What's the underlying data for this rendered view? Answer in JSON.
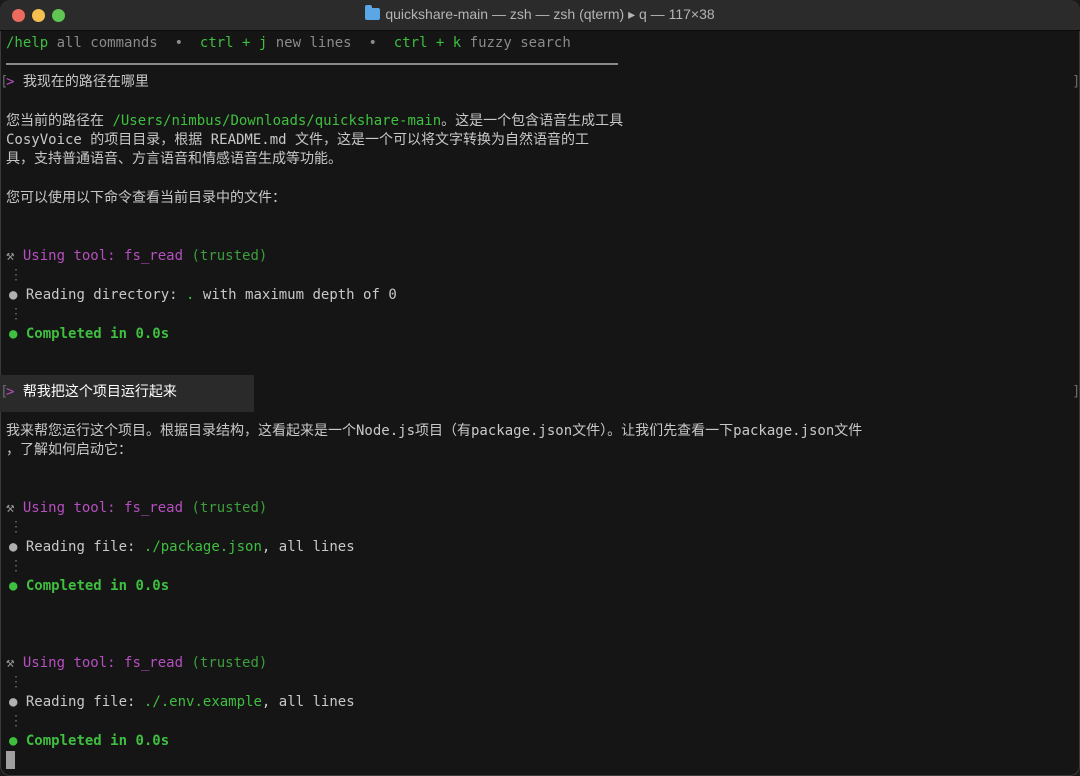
{
  "window": {
    "title": "quickshare-main — zsh — zsh (qterm) ▸ q — 117×38"
  },
  "help_bar": {
    "help_cmd": "/help",
    "help_desc": " all commands",
    "sep1": "  •  ",
    "ctrlj": "ctrl + j",
    "ctrlj_desc": " new lines",
    "sep2": "  •  ",
    "ctrlk": "ctrl + k",
    "ctrlk_desc": " fuzzy search"
  },
  "prompt_char": ">",
  "bracket_left": "[",
  "bracket_right": "]",
  "conversation": {
    "q1": "我现在的路径在哪里",
    "a1_line1_pre": "您当前的路径在 ",
    "a1_path": "/Users/nimbus/Downloads/quickshare-main",
    "a1_line1_post": "。这是一个包含语音生成工具",
    "a1_line2": "CosyVoice 的项目目录，根据 README.md 文件，这是一个可以将文字转换为自然语音的工",
    "a1_line3": "具，支持普通语音、方言语音和情感语音生成等功能。",
    "a1_line4": "您可以使用以下命令查看当前目录中的文件：",
    "tool1_using": "Using tool: fs_read",
    "tool1_trusted": " (trusted)",
    "tool1_reading_label": "Reading directory: ",
    "tool1_reading_target": ".",
    "tool1_reading_rest": " with maximum depth of 0",
    "tool1_completed": "Completed in 0.0s",
    "q2": "帮我把这个项目运行起来",
    "a2_line1": "我来帮您运行这个项目。根据目录结构，这看起来是一个Node.js项目（有package.json文件）。让我们先查看一下package.json文件",
    "a2_line2": "，了解如何启动它：",
    "tool2_using": "Using tool: fs_read",
    "tool2_trusted": " (trusted)",
    "tool2_reading_label": "Reading file: ",
    "tool2_reading_target": "./package.json",
    "tool2_reading_rest": ", all lines",
    "tool2_completed": "Completed in 0.0s",
    "tool3_using": "Using tool: fs_read",
    "tool3_trusted": " (trusted)",
    "tool3_reading_label": "Reading file: ",
    "tool3_reading_target": "./.env.example",
    "tool3_reading_rest": ", all lines",
    "tool3_completed": "Completed in 0.0s"
  },
  "glyphs": {
    "tool_icon": "⚒",
    "bullet": "●",
    "vdots": "⋮"
  },
  "icons": {
    "folder": "folder-icon",
    "tool": "hammer-wrench-icon",
    "bullet": "status-dot-icon",
    "cursor": "block-cursor"
  },
  "colors": {
    "accent_green": "#3fbf3f",
    "tool_purple": "#b64fbf",
    "background": "#151515"
  }
}
